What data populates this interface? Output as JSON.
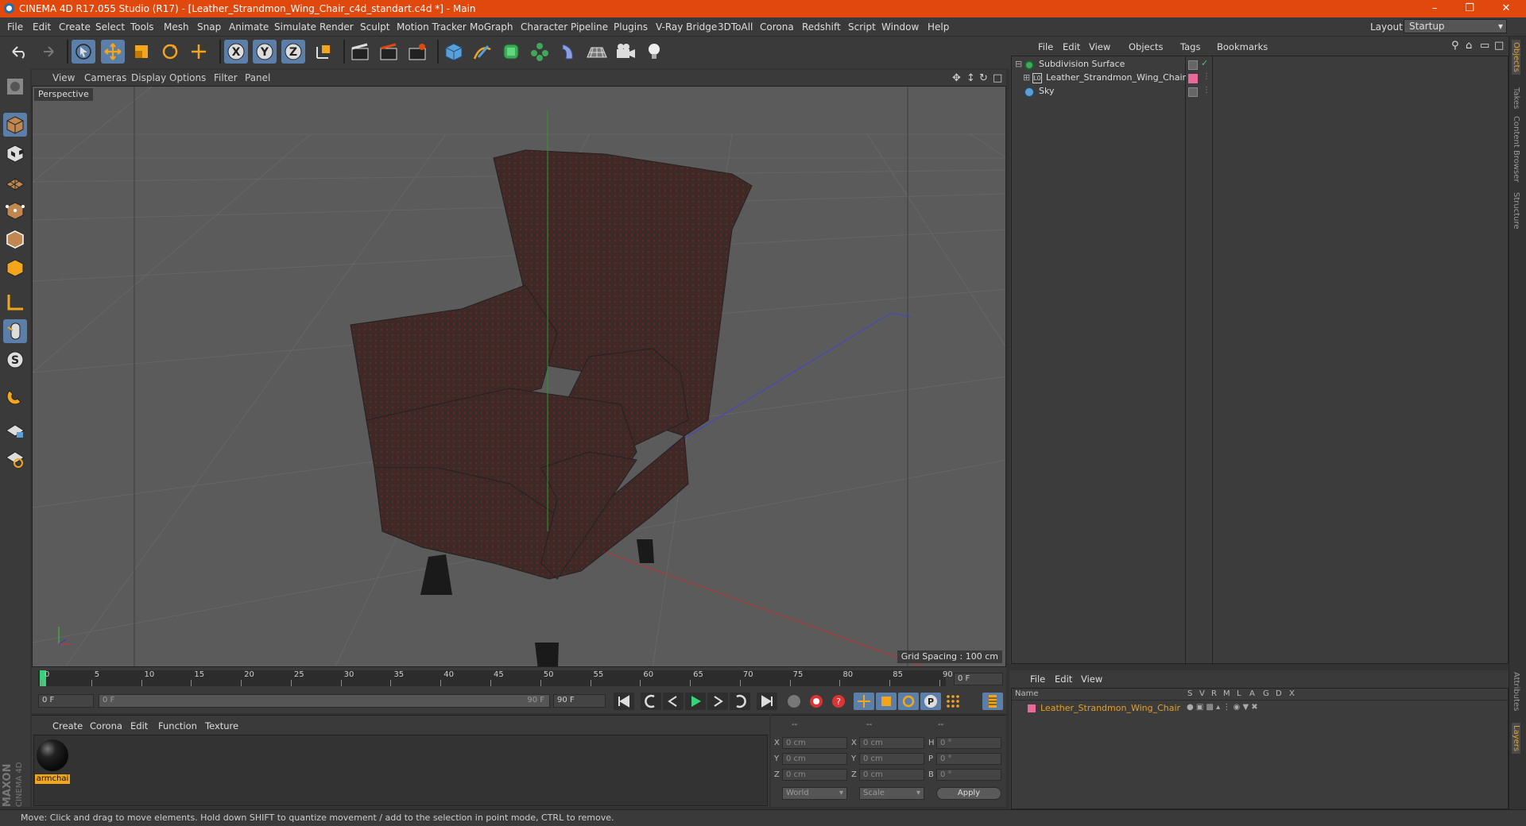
{
  "titlebar": {
    "title": "CINEMA 4D R17.055 Studio (R17) - [Leather_Strandmon_Wing_Chair_c4d_standart.c4d *] - Main"
  },
  "menubar": {
    "items": [
      "File",
      "Edit",
      "Create",
      "Select",
      "Tools",
      "Mesh",
      "Snap",
      "Animate",
      "Simulate",
      "Render",
      "Sculpt",
      "Motion Tracker",
      "MoGraph",
      "Character",
      "Pipeline",
      "Plugins",
      "V-Ray Bridge",
      "3DToAll",
      "Corona",
      "Redshift",
      "Script",
      "Window",
      "Help"
    ],
    "layout_label": "Layout:",
    "layout_value": "Startup"
  },
  "viewport": {
    "menu": [
      "View",
      "Cameras",
      "Display",
      "Options",
      "Filter",
      "Panel"
    ],
    "name": "Perspective",
    "grid_spacing": "Grid Spacing : 100 cm"
  },
  "timeline": {
    "ticks": [
      "0",
      "5",
      "10",
      "15",
      "20",
      "25",
      "30",
      "35",
      "40",
      "45",
      "50",
      "55",
      "60",
      "65",
      "70",
      "75",
      "80",
      "85",
      "90"
    ],
    "current_frame": "0 F"
  },
  "playback": {
    "start": "0 F",
    "range_start": "0 F",
    "range_end": "90 F",
    "end": "90 F"
  },
  "material_panel": {
    "menu": [
      "Create",
      "Corona",
      "Edit",
      "Function",
      "Texture"
    ],
    "material_name": "armchai"
  },
  "coordinates": {
    "headers": [
      "--",
      "--",
      "--"
    ],
    "rows": [
      {
        "a": "X",
        "av": "0 cm",
        "b": "X",
        "bv": "0 cm",
        "c": "H",
        "cv": "0 °"
      },
      {
        "a": "Y",
        "av": "0 cm",
        "b": "Y",
        "bv": "0 cm",
        "c": "P",
        "cv": "0 °"
      },
      {
        "a": "Z",
        "av": "0 cm",
        "b": "Z",
        "bv": "0 cm",
        "c": "B",
        "cv": "0 °"
      }
    ],
    "mode": "World",
    "scale": "Scale",
    "apply": "Apply"
  },
  "object_manager": {
    "menu": [
      "File",
      "Edit",
      "View",
      "Objects",
      "Tags",
      "Bookmarks"
    ],
    "objects": [
      {
        "name": "Subdivision Surface"
      },
      {
        "name": "Leather_Strandmon_Wing_Chair"
      },
      {
        "name": "Sky"
      }
    ]
  },
  "layer_manager": {
    "menu": [
      "File",
      "Edit",
      "View"
    ],
    "columns": [
      "Name",
      "S",
      "V",
      "R",
      "M",
      "L",
      "A",
      "G",
      "D",
      "X"
    ],
    "layer_name": "Leather_Strandmon_Wing_Chair"
  },
  "right_tabs": [
    "Objects",
    "Takes",
    "Content Browser",
    "Structure",
    "Attributes",
    "Layers"
  ],
  "status": "Move: Click and drag to move elements. Hold down SHIFT to quantize movement / add to the selection in point mode, CTRL to remove.",
  "brand": {
    "line1": "MAXON",
    "line2": "CINEMA 4D"
  },
  "colors": {
    "accent": "#e0480e",
    "active": "#5b7fa8",
    "layer": "#e8a020",
    "tag_pink": "#e86a9a"
  }
}
